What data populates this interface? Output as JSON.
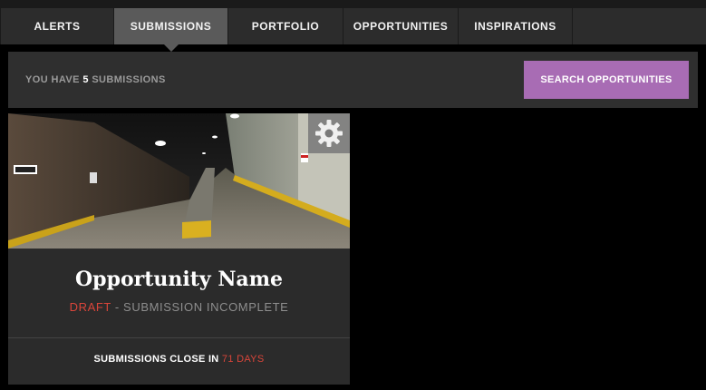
{
  "nav": {
    "tabs": [
      {
        "label": "ALERTS",
        "active": false
      },
      {
        "label": "SUBMISSIONS",
        "active": true
      },
      {
        "label": "PORTFOLIO",
        "active": false
      },
      {
        "label": "OPPORTUNITIES",
        "active": false
      },
      {
        "label": "INSPIRATIONS",
        "active": false
      }
    ]
  },
  "subheader": {
    "count_prefix": "YOU HAVE",
    "count": "5",
    "count_suffix": "SUBMISSIONS",
    "search_button": "SEARCH OPPORTUNITIES"
  },
  "card": {
    "title": "Opportunity Name",
    "status_draft": "DRAFT",
    "status_rest": " - SUBMISSION INCOMPLETE",
    "close_prefix": "SUBMISSIONS CLOSE IN",
    "close_days": "71 DAYS",
    "image": "parking-garage-photo",
    "settings_icon": "gear-icon"
  },
  "colors": {
    "accent_purple": "#a86cb4",
    "alert_red": "#d9453a",
    "tab_active": "#5a5a5a"
  }
}
